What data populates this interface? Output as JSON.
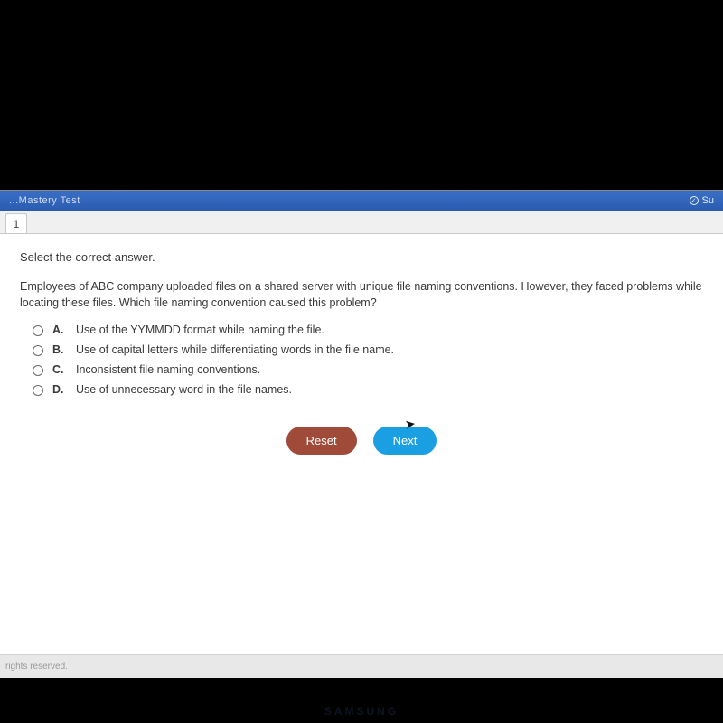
{
  "header": {
    "title_fragment": "...Mastery Test",
    "submit_fragment": "Su"
  },
  "question_tab": "1",
  "instruction": "Select the correct answer.",
  "prompt": "Employees of ABC company uploaded files on a shared server with unique file naming conventions. However, they faced problems while locating these files. Which file naming convention caused this problem?",
  "options": [
    {
      "letter": "A.",
      "text": "Use of the YYMMDD format while naming the file."
    },
    {
      "letter": "B.",
      "text": "Use of capital letters while differentiating words in the file name."
    },
    {
      "letter": "C.",
      "text": "Inconsistent file naming conventions."
    },
    {
      "letter": "D.",
      "text": "Use of unnecessary word in the file names."
    }
  ],
  "buttons": {
    "reset": "Reset",
    "next": "Next"
  },
  "footer": "rights reserved.",
  "brand": "SAMSUNG"
}
